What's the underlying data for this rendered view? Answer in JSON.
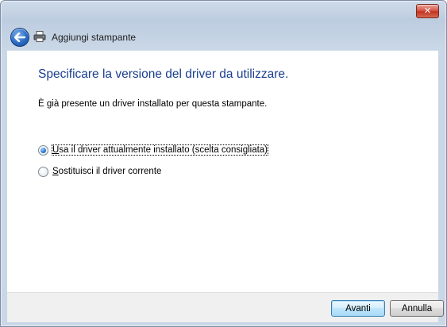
{
  "window": {
    "close_symbol": "✕"
  },
  "header": {
    "title": "Aggiungi stampante",
    "back_icon": "back-arrow-icon",
    "app_icon": "printer-icon"
  },
  "content": {
    "main_instruction": "Specificare la versione del driver da utilizzare.",
    "description": "È già presente un driver installato per questa stampante.",
    "options": [
      {
        "pre": "",
        "key": "U",
        "post": "sa il driver attualmente installato (scelta consigliata)",
        "checked": true
      },
      {
        "pre": "",
        "key": "S",
        "post": "ostituisci il driver corrente",
        "checked": false
      }
    ]
  },
  "footer": {
    "next_label": "Avanti",
    "cancel_label": "Annulla"
  },
  "colors": {
    "instruction": "#1a3e8f",
    "close": "#c2341f"
  }
}
